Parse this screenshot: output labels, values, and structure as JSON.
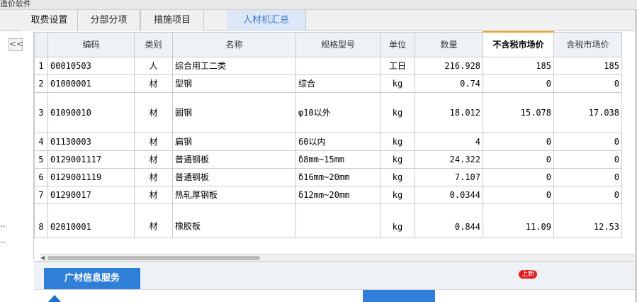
{
  "window": {
    "title": "造价软件"
  },
  "tabs": [
    {
      "label": "取费设置",
      "active": false
    },
    {
      "label": "分部分项",
      "active": false
    },
    {
      "label": "措施项目",
      "active": false
    },
    {
      "label": "人材机汇总",
      "active": true
    }
  ],
  "left_panel": {
    "collapse_label": "<<",
    "truncated_1": "..",
    "truncated_2": ".."
  },
  "table": {
    "columns": [
      "编码",
      "类别",
      "名称",
      "规格型号",
      "单位",
      "数量",
      "不含税市场价",
      "含税市场价"
    ],
    "rows": [
      {
        "seq": "1",
        "code": "00010503",
        "cat": "人",
        "name": "综合用工二类",
        "spec": "",
        "unit": "工日",
        "qty": "216.928",
        "price_ex": "185",
        "price_in": "185"
      },
      {
        "seq": "2",
        "code": "01000001",
        "cat": "材",
        "name": "型钢",
        "spec": "综合",
        "unit": "kg",
        "qty": "0.74",
        "price_ex": "0",
        "price_in": "0"
      },
      {
        "seq": "3",
        "code": "01090010",
        "cat": "材",
        "name": "圆钢",
        "spec": "φ10以外",
        "unit": "kg",
        "qty": "18.012",
        "price_ex": "15.078",
        "price_in": "17.038"
      },
      {
        "seq": "4",
        "code": "01130003",
        "cat": "材",
        "name": "扁钢",
        "spec": "60以内",
        "unit": "kg",
        "qty": "4",
        "price_ex": "0",
        "price_in": "0"
      },
      {
        "seq": "5",
        "code": "0129001117",
        "cat": "材",
        "name": "普通钢板",
        "spec": "δ8mm~15mm",
        "unit": "kg",
        "qty": "24.322",
        "price_ex": "0",
        "price_in": "0"
      },
      {
        "seq": "6",
        "code": "0129001119",
        "cat": "材",
        "name": "普通钢板",
        "spec": "δ16mm~20mm",
        "unit": "kg",
        "qty": "7.107",
        "price_ex": "0",
        "price_in": "0"
      },
      {
        "seq": "7",
        "code": "01290017",
        "cat": "材",
        "name": "热轧厚钢板",
        "spec": "δ12mm~20mm",
        "unit": "kg",
        "qty": "0.0344",
        "price_ex": "0",
        "price_in": "0"
      },
      {
        "seq": "8",
        "code": "02010001",
        "cat": "材",
        "name": "橡胶板",
        "spec": "",
        "unit": "kg",
        "qty": "0.844",
        "price_ex": "11.09",
        "price_in": "12.53"
      }
    ]
  },
  "bottom": {
    "tab_label": "广材信息服务",
    "badge": "上新"
  },
  "colors": {
    "accent": "#2f7fd8",
    "highlight_border": "#f0a020",
    "badge": "#e02020"
  }
}
